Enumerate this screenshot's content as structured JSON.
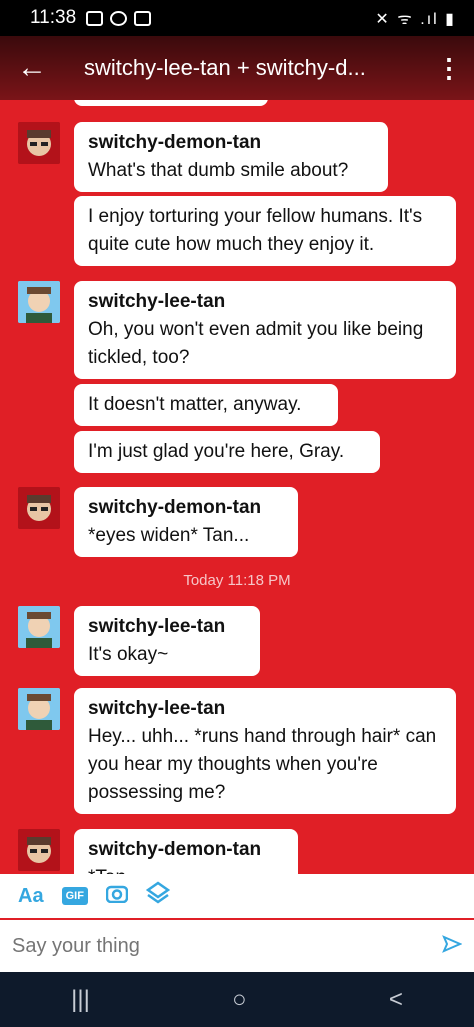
{
  "status": {
    "time": "11:38",
    "right_icons": "✕ ᯤ .ıl ▮"
  },
  "header": {
    "title": "switchy-lee-tan + switchy-d...",
    "back": "←",
    "more": "⋮"
  },
  "messages": [
    {
      "sender": "switchy-demon-tan",
      "texts": [
        "What's that dumb smile about?",
        "I enjoy torturing your fellow humans. It's quite cute how much they enjoy it."
      ]
    },
    {
      "sender": "switchy-lee-tan",
      "texts": [
        "Oh, you won't even admit you like being tickled, too?",
        "It doesn't matter, anyway.",
        "I'm just glad you're here, Gray."
      ]
    },
    {
      "sender": "switchy-demon-tan",
      "texts": [
        "*eyes widen* Tan..."
      ]
    },
    {
      "timestamp": "Today 11:18 PM"
    },
    {
      "sender": "switchy-lee-tan",
      "texts": [
        "It's okay~"
      ]
    },
    {
      "sender": "switchy-lee-tan",
      "texts": [
        "Hey... uhh... *runs hand through hair* can you hear my thoughts when you're possessing me?"
      ]
    },
    {
      "sender": "switchy-demon-tan",
      "texts": [
        "*Tan..."
      ]
    }
  ],
  "compose": {
    "tools": [
      "Aa",
      "GIF",
      "camera-icon",
      "sticker-icon"
    ],
    "placeholder": "Say your thing"
  },
  "nav": {
    "recent": "|||",
    "home": "○",
    "back": "<"
  }
}
